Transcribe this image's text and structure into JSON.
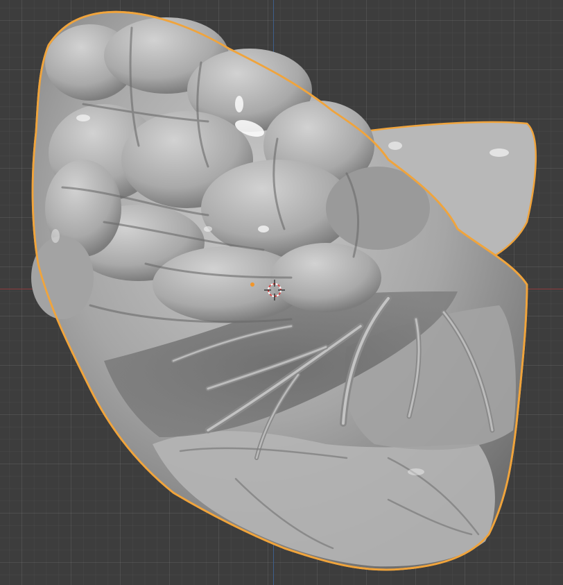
{
  "viewport": {
    "background_color": "#3d3d3d",
    "x_axis_color": "#8f3a3d",
    "y_axis_color": "#3e5f8a"
  },
  "object": {
    "kind": "sculpted organic mesh (heart model)",
    "selected": true,
    "outline_color": "#f0a43c",
    "surface_color": "#a8a8a8",
    "origin_color": "#f2962a"
  },
  "cursor": {
    "icon": "3d-cursor-icon",
    "ring_colors": [
      "#d84a4a",
      "#ffffff"
    ]
  }
}
